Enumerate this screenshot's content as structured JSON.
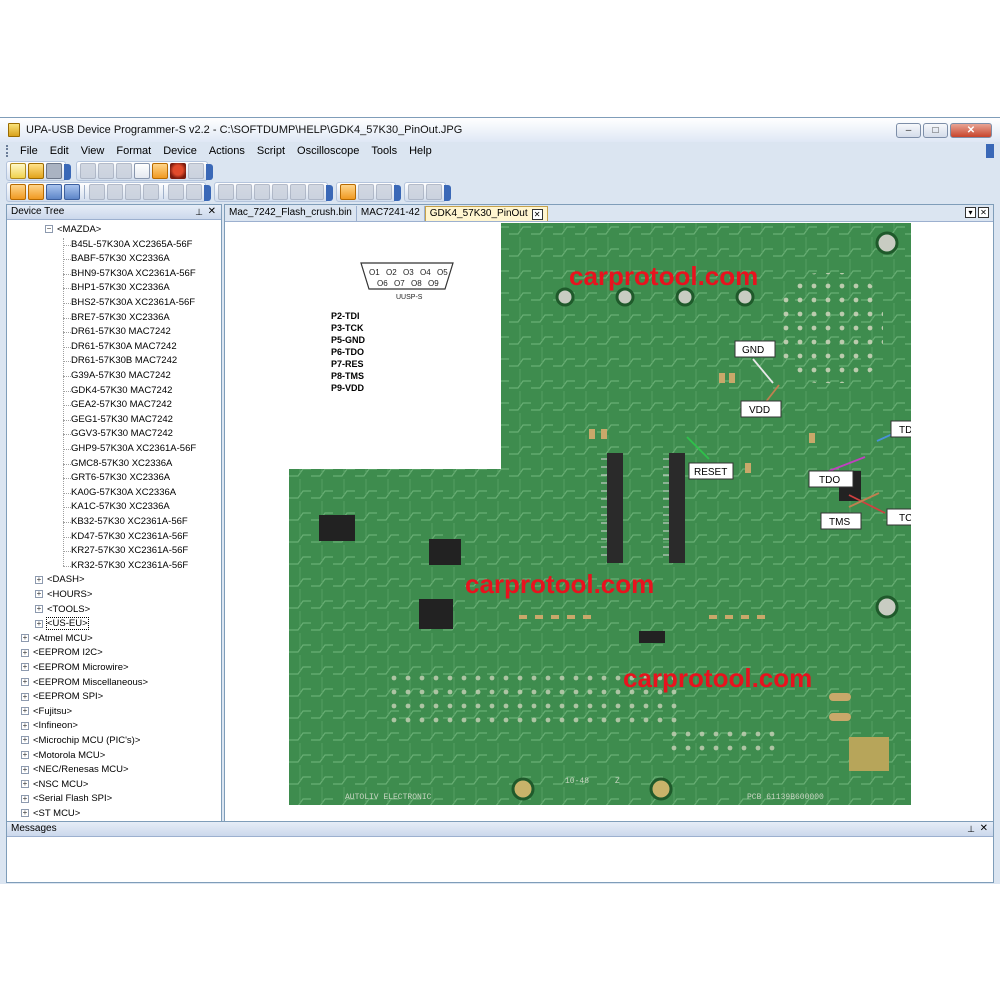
{
  "window": {
    "title": "UPA-USB Device Programmer-S v2.2 - C:\\SOFTDUMP\\HELP\\GDK4_57K30_PinOut.JPG",
    "buttons": {
      "minimize": "‒",
      "maximize": "□",
      "close": "✕"
    }
  },
  "menu": [
    "File",
    "Edit",
    "View",
    "Format",
    "Device",
    "Actions",
    "Script",
    "Oscilloscope",
    "Tools",
    "Help"
  ],
  "device_tree": {
    "title": "Device Tree",
    "pin_glyph": "⊥",
    "close_glyph": "✕",
    "mazda": {
      "label": "<MAZDA>",
      "items": [
        "B45L-57K30A XC2365A-56F",
        "BABF-57K30 XC2336A",
        "BHN9-57K30A XC2361A-56F",
        "BHP1-57K30 XC2336A",
        "BHS2-57K30A XC2361A-56F",
        "BRE7-57K30 XC2336A",
        "DR61-57K30 MAC7242",
        "DR61-57K30A MAC7242",
        "DR61-57K30B MAC7242",
        "G39A-57K30 MAC7242",
        "GDK4-57K30 MAC7242",
        "GEA2-57K30 MAC7242",
        "GEG1-57K30 MAC7242",
        "GGV3-57K30 MAC7242",
        "GHP9-57K30A XC2361A-56F",
        "GMC8-57K30 XC2336A",
        "GRT6-57K30 XC2336A",
        "KA0G-57K30A XC2336A",
        "KA1C-57K30 XC2336A",
        "KB32-57K30 XC2361A-56F",
        "KD47-57K30 XC2361A-56F",
        "KR27-57K30 XC2361A-56F",
        "KR32-57K30 XC2361A-56F"
      ]
    },
    "siblings": [
      "<DASH>",
      "<HOURS>",
      "<TOOLS>",
      "<US-EU>"
    ],
    "roots": [
      "<Atmel MCU>",
      "<EEPROM I2C>",
      "<EEPROM Microwire>",
      "<EEPROM Miscellaneous>",
      "<EEPROM SPI>",
      "<Fujitsu>",
      "<Infineon>",
      "<Microchip MCU (PIC's)>",
      "<Motorola MCU>",
      "<NEC/Renesas MCU>",
      "<NSC MCU>",
      "<Serial Flash SPI>",
      "<ST MCU>"
    ]
  },
  "tabs": [
    {
      "label": "Mac_7242_Flash_crush.bin",
      "active": false
    },
    {
      "label": "MAC7241-42",
      "active": false
    },
    {
      "label": "GDK4_57K30_PinOut",
      "active": true
    }
  ],
  "tab_close_glyph": "✕",
  "image": {
    "connector_label": "UUSP-S",
    "connector_pins_top": [
      "O1",
      "O2",
      "O3",
      "O4",
      "O5"
    ],
    "connector_pins_bottom": [
      "O6",
      "O7",
      "O8",
      "O9"
    ],
    "pin_list": [
      "P2-TDI",
      "P3-TCK",
      "P5-GND",
      "P6-TDO",
      "P7-RES",
      "P8-TMS",
      "P9-VDD"
    ],
    "watermarks": [
      "carprotool.com",
      "carprotool.com",
      "carprotool.com"
    ],
    "labels": {
      "gnd": "GND",
      "vdd": "VDD",
      "tdi": "TDI",
      "reset": "RESET",
      "tdo": "TDO",
      "tms": "TMS",
      "tck": "TCK"
    },
    "board_text": {
      "maker": "AUTOLIV ELECTRONIC",
      "pcb": "PCB 61139B600000",
      "code": "10-48",
      "mark": "Z"
    },
    "colors": {
      "board": "#3e8c4e",
      "board_dark": "#2b6d3a",
      "watermark": "#e8121e",
      "trace": "#7fc08a"
    }
  },
  "messages": {
    "title": "Messages",
    "pin_glyph": "⊥",
    "close_glyph": "✕"
  }
}
